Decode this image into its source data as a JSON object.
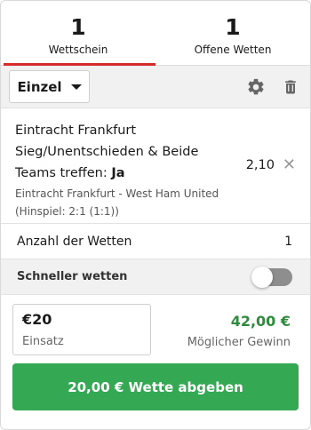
{
  "tabs": [
    {
      "count": "1",
      "label": "Wettschein",
      "active": true
    },
    {
      "count": "1",
      "label": "Offene Wetten",
      "active": false
    }
  ],
  "toolbar": {
    "bet_type": "Einzel",
    "icons": [
      "gear-icon",
      "trash-icon"
    ]
  },
  "bet": {
    "line1": "Eintracht Frankfurt",
    "line2": "Sieg/Unentschieden & Beide",
    "line3_prefix": "Teams treffen: ",
    "line3_pick": "Ja",
    "event": "Eintracht Frankfurt - West Ham United",
    "note": "(Hinspiel: 2:1 (1:1))",
    "odds": "2,10",
    "remove_symbol": "✕"
  },
  "count_row": {
    "label": "Anzahl der Wetten",
    "value": "1"
  },
  "fast_bet": {
    "label": "Schneller wetten",
    "enabled": false
  },
  "stake": {
    "value": "€20",
    "caption": "Einsatz"
  },
  "win": {
    "amount": "42,00 €",
    "caption": "Möglicher Gewinn"
  },
  "submit_label": "20,00 € Wette abgeben",
  "colors": {
    "accent_red": "#d62b2b",
    "green": "#35a853",
    "win_green": "#2e8b3c"
  }
}
